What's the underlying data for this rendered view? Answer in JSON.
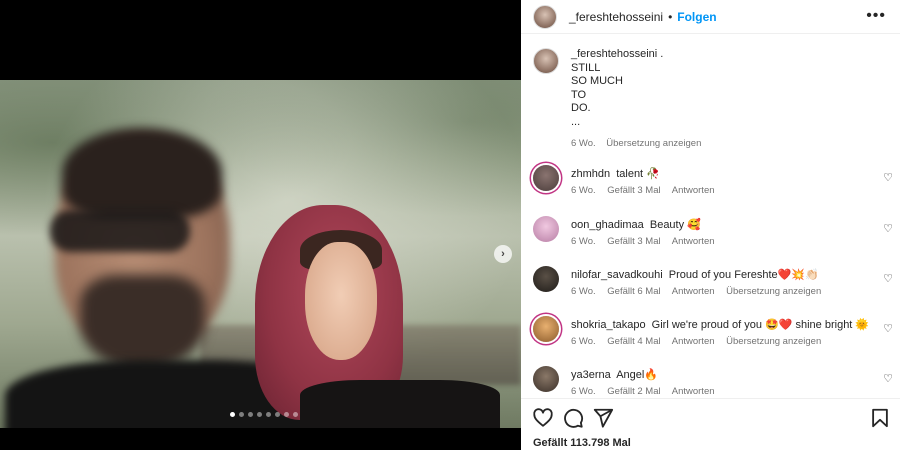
{
  "post": {
    "image_dots": 8,
    "active_dot": 0,
    "next_icon": "chevron-right-icon"
  },
  "header": {
    "username": "_fereshtehosseini",
    "separator": "•",
    "follow_label": "Folgen",
    "more_label": "•••"
  },
  "caption": {
    "username": "_fereshtehosseini",
    "suffix": " .",
    "lines": [
      "STILL",
      "SO MUCH",
      "TO",
      "DO.",
      "..."
    ],
    "age": "6 Wo.",
    "translate": "Übersetzung anzeigen"
  },
  "comments": [
    {
      "username": "zhmhdn",
      "text": "talent 🥀",
      "age": "6 Wo.",
      "likes": "Gefällt 3 Mal",
      "reply": "Antworten",
      "translate": "",
      "avatar_color": "#6b5a58"
    },
    {
      "username": "oon_ghadimaa",
      "text": "Beauty 🥰",
      "age": "6 Wo.",
      "likes": "Gefällt 3 Mal",
      "reply": "Antworten",
      "translate": "",
      "avatar_color": "#d9a7c9"
    },
    {
      "username": "nilofar_savadkouhi",
      "text": "Proud of you Fereshte❤️💥👏🏻",
      "age": "6 Wo.",
      "likes": "Gefällt 6 Mal",
      "reply": "Antworten",
      "translate": "Übersetzung anzeigen",
      "avatar_color": "#2f2b27"
    },
    {
      "username": "shokria_takapo",
      "text": "Girl we're proud of you 🤩❤️ shine bright 🌞",
      "age": "6 Wo.",
      "likes": "Gefällt 4 Mal",
      "reply": "Antworten",
      "translate": "Übersetzung anzeigen",
      "avatar_color": "#c98a3a"
    },
    {
      "username": "ya3erna",
      "text": "Angel🔥",
      "age": "6 Wo.",
      "likes": "Gefällt 2 Mal",
      "reply": "Antworten",
      "translate": "",
      "avatar_color": "#5a4a40"
    }
  ],
  "actions": {
    "like_icon": "heart-icon",
    "comment_icon": "comment-icon",
    "share_icon": "send-icon",
    "save_icon": "bookmark-icon"
  },
  "likes_total": "Gefällt 113.798 Mal"
}
